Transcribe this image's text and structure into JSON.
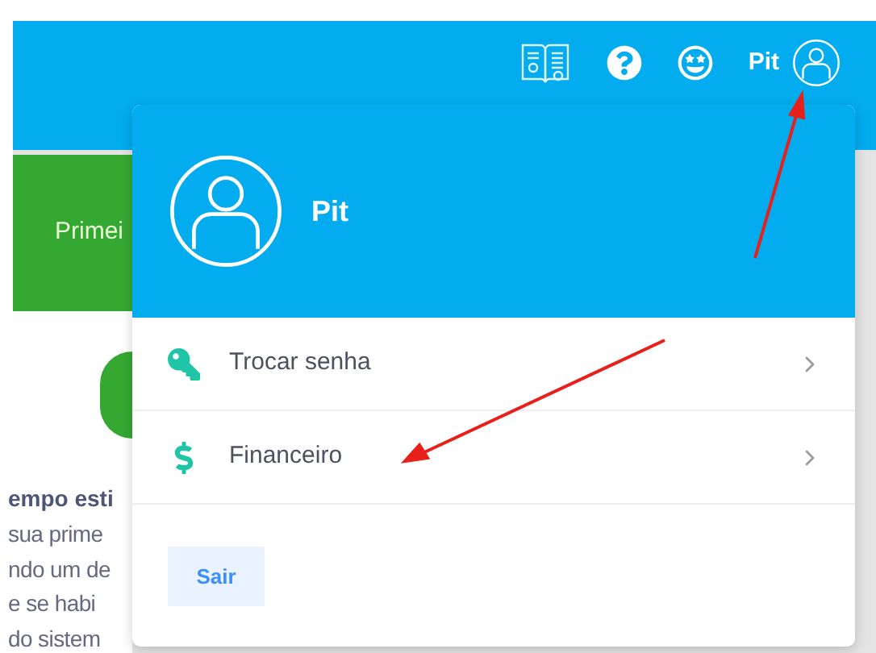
{
  "header": {
    "user_name": "Pit"
  },
  "background": {
    "banner": "Primei",
    "heading": "empo esti",
    "lines": [
      "sua prime",
      "ndo um de",
      "e se habi",
      "do sistem"
    ]
  },
  "menu": {
    "user_name": "Pit",
    "items": [
      {
        "label": "Trocar senha",
        "kind": "key"
      },
      {
        "label": "Financeiro",
        "kind": "dollar"
      }
    ],
    "logout": "Sair"
  }
}
